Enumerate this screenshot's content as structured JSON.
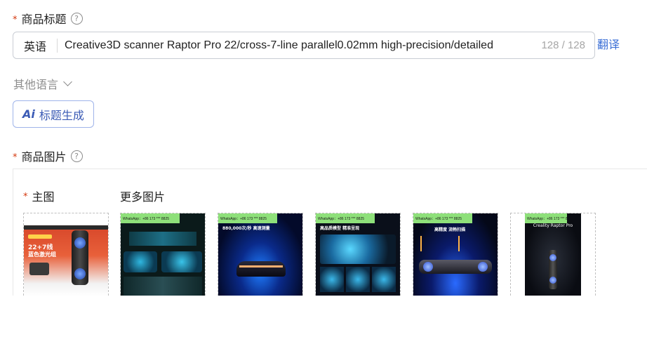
{
  "product_title": {
    "label": "商品标题",
    "help_icon": "?",
    "language_tag": "英语",
    "value": "Creative3D scanner Raptor Pro 22/cross-7-line parallel0.02mm high-precision/detailed",
    "counter": "128 / 128",
    "translate_label": "翻译"
  },
  "other_languages": {
    "label": "其他语言"
  },
  "ai_button": {
    "mark": "Ai",
    "label": "标题生成"
  },
  "product_images": {
    "label": "商品图片",
    "help_icon": "?",
    "main_label": "主图",
    "more_label": "更多图片",
    "main_image": {
      "badge_line1": "22+7线",
      "badge_line2": "蓝色激光组"
    },
    "watermark": "WhatsApp：+86 173 *** 8825",
    "more_images": [
      {
        "caption": ""
      },
      {
        "caption": "880,000次/秒 高速测量"
      },
      {
        "caption": "高品质模型 精准呈现"
      },
      {
        "caption": "高精度 流畅扫描"
      },
      {
        "caption": "Creality Raptor Pro"
      }
    ]
  }
}
